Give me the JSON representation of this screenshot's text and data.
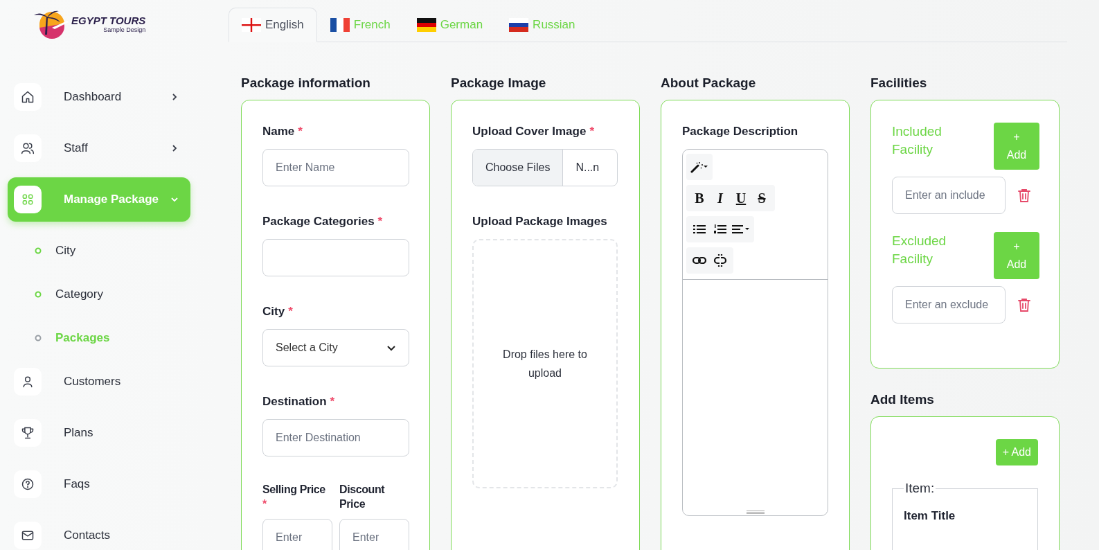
{
  "logo": {
    "title": "EGYPT TOURS",
    "subtitle": "Sample Design"
  },
  "tabs": [
    {
      "label": "English",
      "selected": true
    },
    {
      "label": "French",
      "selected": false
    },
    {
      "label": "German",
      "selected": false
    },
    {
      "label": "Russian",
      "selected": false
    }
  ],
  "sidebar": {
    "items": [
      {
        "label": "Dashboard",
        "kind": "group",
        "expanded": false,
        "selected": false
      },
      {
        "label": "Staff",
        "kind": "group",
        "expanded": false,
        "selected": false
      },
      {
        "label": "Manage Package",
        "kind": "group",
        "expanded": true,
        "selected": true,
        "children": [
          {
            "label": "City",
            "selected": false
          },
          {
            "label": "Category",
            "selected": false
          },
          {
            "label": "Packages",
            "selected": true
          }
        ]
      },
      {
        "label": "Customers",
        "kind": "link",
        "selected": false
      },
      {
        "label": "Plans",
        "kind": "link",
        "selected": false
      },
      {
        "label": "Faqs",
        "kind": "link",
        "selected": false
      },
      {
        "label": "Contacts",
        "kind": "link",
        "selected": false
      }
    ]
  },
  "package_information": {
    "title": "Package information",
    "fields": [
      {
        "kind": "text",
        "label": "Name",
        "required_mark": "*",
        "placeholder": "Enter Name"
      },
      {
        "kind": "text",
        "label": "Package Categories",
        "required_mark": "*"
      },
      {
        "kind": "select",
        "label": "City",
        "required_mark": "*",
        "value": "Select a City"
      },
      {
        "kind": "text",
        "label": "Destination",
        "required_mark": "*",
        "placeholder": "Enter Destination"
      }
    ],
    "prices": [
      {
        "label": "Selling Price",
        "required_mark": "*",
        "placeholder": "Enter"
      },
      {
        "label": "Discount Price",
        "placeholder": "Enter"
      }
    ]
  },
  "package_image": {
    "title": "Package Image",
    "cover": {
      "label": "Upload Cover Image",
      "required_mark": "*",
      "button": "Choose Files",
      "file_name": "N...n"
    },
    "images": {
      "label": "Upload Package Images",
      "dropzone": "Drop files here to upload"
    }
  },
  "about_package": {
    "title": "About Package",
    "editor": {
      "label": "Package Description",
      "format_buttons": [
        "B",
        "I",
        "U",
        "S"
      ]
    }
  },
  "facilities": {
    "title": "Facilities",
    "groups": [
      {
        "label": "Included Facility",
        "button": "+ Add",
        "placeholder": "Enter an include"
      },
      {
        "label": "Excluded Facility",
        "button": "+ Add",
        "placeholder": "Enter an exclude"
      }
    ]
  },
  "add_items": {
    "title": "Add Items",
    "button": "+ Add",
    "legend": "Item:",
    "field_label": "Item Title"
  }
}
